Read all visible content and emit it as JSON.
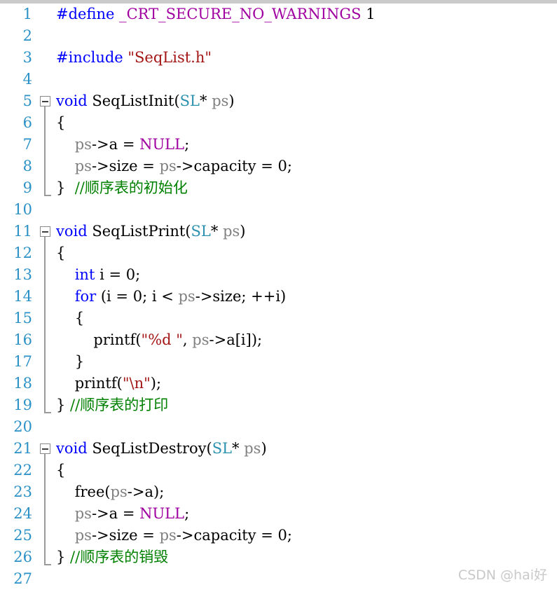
{
  "editor": {
    "language": "C",
    "gutter_color": "#2b91c6",
    "background": "#ffffff",
    "watermark": "CSDN @hai好",
    "colors": {
      "keyword": "#0000ff",
      "type": "#2b91af",
      "macro": "#a000a0",
      "string": "#a31515",
      "comment": "#008000",
      "variable": "#808080",
      "plain": "#000000",
      "fold_border": "#8a8a8a",
      "fold_line": "#9a9a9a"
    },
    "lines": [
      {
        "number": "1",
        "fold": "none",
        "tokens": [
          {
            "t": "#define ",
            "c": "kw"
          },
          {
            "t": "_CRT_SECURE_NO_WARNINGS",
            "c": "mac"
          },
          {
            "t": " 1",
            "c": "num"
          }
        ]
      },
      {
        "number": "2",
        "fold": "none",
        "tokens": []
      },
      {
        "number": "3",
        "fold": "none",
        "tokens": [
          {
            "t": "#include ",
            "c": "kw"
          },
          {
            "t": "\"SeqList.h\"",
            "c": "str"
          }
        ]
      },
      {
        "number": "4",
        "fold": "none",
        "tokens": []
      },
      {
        "number": "5",
        "fold": "start",
        "tokens": [
          {
            "t": "void",
            "c": "kw"
          },
          {
            "t": " SeqListInit(",
            "c": "pln"
          },
          {
            "t": "SL",
            "c": "type"
          },
          {
            "t": "* ",
            "c": "pln"
          },
          {
            "t": "ps",
            "c": "var"
          },
          {
            "t": ")",
            "c": "pln"
          }
        ]
      },
      {
        "number": "6",
        "fold": "body",
        "tokens": [
          {
            "t": "{",
            "c": "pln"
          }
        ]
      },
      {
        "number": "7",
        "fold": "body",
        "tokens": [
          {
            "t": "    ",
            "c": "pln"
          },
          {
            "t": "ps",
            "c": "var"
          },
          {
            "t": "->a = ",
            "c": "pln"
          },
          {
            "t": "NULL",
            "c": "mac"
          },
          {
            "t": ";",
            "c": "pln"
          }
        ]
      },
      {
        "number": "8",
        "fold": "body",
        "tokens": [
          {
            "t": "    ",
            "c": "pln"
          },
          {
            "t": "ps",
            "c": "var"
          },
          {
            "t": "->size = ",
            "c": "pln"
          },
          {
            "t": "ps",
            "c": "var"
          },
          {
            "t": "->capacity = 0;",
            "c": "pln"
          }
        ]
      },
      {
        "number": "9",
        "fold": "end",
        "tokens": [
          {
            "t": "}  ",
            "c": "pln"
          },
          {
            "t": "//顺序表的初始化",
            "c": "cmt"
          }
        ]
      },
      {
        "number": "10",
        "fold": "none",
        "tokens": []
      },
      {
        "number": "11",
        "fold": "start",
        "tokens": [
          {
            "t": "void",
            "c": "kw"
          },
          {
            "t": " SeqListPrint(",
            "c": "pln"
          },
          {
            "t": "SL",
            "c": "type"
          },
          {
            "t": "* ",
            "c": "pln"
          },
          {
            "t": "ps",
            "c": "var"
          },
          {
            "t": ")",
            "c": "pln"
          }
        ]
      },
      {
        "number": "12",
        "fold": "body",
        "tokens": [
          {
            "t": "{",
            "c": "pln"
          }
        ]
      },
      {
        "number": "13",
        "fold": "body",
        "tokens": [
          {
            "t": "    ",
            "c": "pln"
          },
          {
            "t": "int",
            "c": "kw"
          },
          {
            "t": " i = 0;",
            "c": "pln"
          }
        ]
      },
      {
        "number": "14",
        "fold": "body",
        "tokens": [
          {
            "t": "    ",
            "c": "pln"
          },
          {
            "t": "for",
            "c": "kw"
          },
          {
            "t": " (i = 0; i < ",
            "c": "pln"
          },
          {
            "t": "ps",
            "c": "var"
          },
          {
            "t": "->size; ++i)",
            "c": "pln"
          }
        ]
      },
      {
        "number": "15",
        "fold": "body",
        "tokens": [
          {
            "t": "    {",
            "c": "pln"
          }
        ]
      },
      {
        "number": "16",
        "fold": "body",
        "tokens": [
          {
            "t": "        printf(",
            "c": "pln"
          },
          {
            "t": "\"%d \"",
            "c": "str"
          },
          {
            "t": ", ",
            "c": "pln"
          },
          {
            "t": "ps",
            "c": "var"
          },
          {
            "t": "->a[i]);",
            "c": "pln"
          }
        ]
      },
      {
        "number": "17",
        "fold": "body",
        "tokens": [
          {
            "t": "    }",
            "c": "pln"
          }
        ]
      },
      {
        "number": "18",
        "fold": "body",
        "tokens": [
          {
            "t": "    printf(",
            "c": "pln"
          },
          {
            "t": "\"\\n\"",
            "c": "str"
          },
          {
            "t": ");",
            "c": "pln"
          }
        ]
      },
      {
        "number": "19",
        "fold": "end",
        "tokens": [
          {
            "t": "} ",
            "c": "pln"
          },
          {
            "t": "//顺序表的打印",
            "c": "cmt"
          }
        ]
      },
      {
        "number": "20",
        "fold": "none",
        "tokens": []
      },
      {
        "number": "21",
        "fold": "start",
        "tokens": [
          {
            "t": "void",
            "c": "kw"
          },
          {
            "t": " SeqListDestroy(",
            "c": "pln"
          },
          {
            "t": "SL",
            "c": "type"
          },
          {
            "t": "* ",
            "c": "pln"
          },
          {
            "t": "ps",
            "c": "var"
          },
          {
            "t": ")",
            "c": "pln"
          }
        ]
      },
      {
        "number": "22",
        "fold": "body",
        "tokens": [
          {
            "t": "{",
            "c": "pln"
          }
        ]
      },
      {
        "number": "23",
        "fold": "body",
        "tokens": [
          {
            "t": "    free(",
            "c": "pln"
          },
          {
            "t": "ps",
            "c": "var"
          },
          {
            "t": "->a);",
            "c": "pln"
          }
        ]
      },
      {
        "number": "24",
        "fold": "body",
        "tokens": [
          {
            "t": "    ",
            "c": "pln"
          },
          {
            "t": "ps",
            "c": "var"
          },
          {
            "t": "->a = ",
            "c": "pln"
          },
          {
            "t": "NULL",
            "c": "mac"
          },
          {
            "t": ";",
            "c": "pln"
          }
        ]
      },
      {
        "number": "25",
        "fold": "body",
        "tokens": [
          {
            "t": "    ",
            "c": "pln"
          },
          {
            "t": "ps",
            "c": "var"
          },
          {
            "t": "->size = ",
            "c": "pln"
          },
          {
            "t": "ps",
            "c": "var"
          },
          {
            "t": "->capacity = 0;",
            "c": "pln"
          }
        ]
      },
      {
        "number": "26",
        "fold": "end",
        "tokens": [
          {
            "t": "} ",
            "c": "pln"
          },
          {
            "t": "//顺序表的销毁",
            "c": "cmt"
          }
        ]
      },
      {
        "number": "27",
        "fold": "none",
        "tokens": []
      }
    ]
  }
}
